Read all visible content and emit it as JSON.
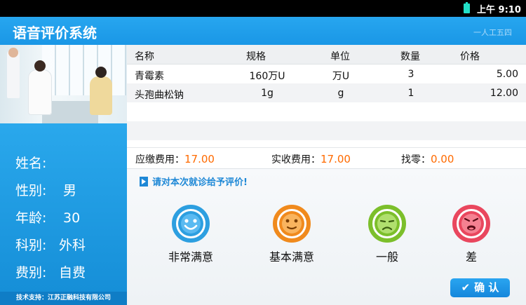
{
  "status_bar": {
    "time": "上午 9:10",
    "battery_icon": "battery-icon"
  },
  "app": {
    "title": "语音评价系统",
    "header_right_text": "一人工五四"
  },
  "patient": {
    "labels": {
      "name": "姓名:",
      "gender": "性别:",
      "age": "年龄:",
      "dept": "科别:",
      "fee_type": "费别:"
    },
    "name": "",
    "gender": "男",
    "age": "30",
    "dept": "外科",
    "fee_type": "自费"
  },
  "tech_support": "技术支持：江苏正融科技有限公司",
  "table": {
    "headers": {
      "name": "名称",
      "spec": "规格",
      "unit": "单位",
      "qty": "数量",
      "price": "价格"
    },
    "rows": [
      {
        "name": "青霉素",
        "spec": "160万U",
        "unit": "万U",
        "qty": "3",
        "price": "5.00"
      },
      {
        "name": "头孢曲松钠",
        "spec": "1g",
        "unit": "g",
        "qty": "1",
        "price": "12.00"
      }
    ]
  },
  "fees": {
    "due_label": "应缴费用：",
    "due_value": "17.00",
    "paid_label": "实收费用：",
    "paid_value": "17.00",
    "change_label": "找零：",
    "change_value": "0.00"
  },
  "rating": {
    "prompt": "请对本次就诊给予评价!",
    "options": [
      {
        "label": "非常满意",
        "icon": "very-satisfied-face-icon",
        "color": "#2d9fe0"
      },
      {
        "label": "基本满意",
        "icon": "satisfied-face-icon",
        "color": "#f08a1d"
      },
      {
        "label": "一般",
        "icon": "neutral-face-icon",
        "color": "#7cbf2b"
      },
      {
        "label": "差",
        "icon": "unhappy-face-icon",
        "color": "#e9475e"
      }
    ]
  },
  "confirm_button": {
    "label": "确 认",
    "icon": "check-icon"
  }
}
